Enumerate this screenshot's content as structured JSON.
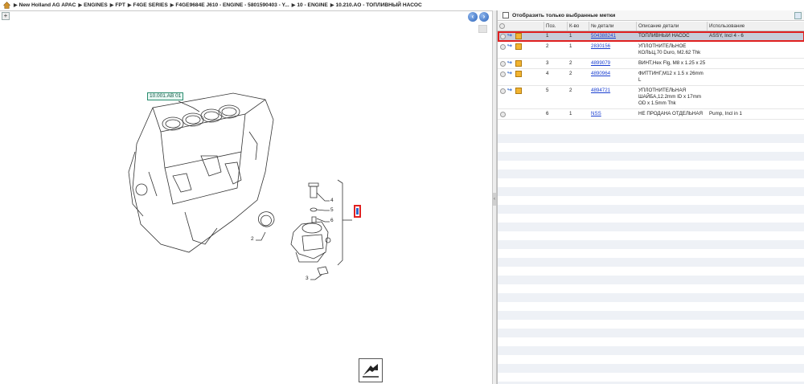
{
  "breadcrumb": {
    "items": [
      "New Holland AG APAC",
      "ENGINES",
      "FPT",
      "F4GE SERIES",
      "F4GE9684E J610 - ENGINE - 5801590403 - Y...",
      "10 - ENGINE",
      "10.210.AO - ТОПЛИВНЫЙ НАСОС"
    ]
  },
  "drawing": {
    "reference_label": "10.001.AB 01",
    "callouts": [
      "2",
      "3",
      "4",
      "5",
      "6"
    ]
  },
  "filter": {
    "label": "Отобразить только выбранные метки"
  },
  "grid": {
    "headers": {
      "pos": "Поз.",
      "qty": "К-во",
      "number": "№ детали",
      "description": "Описание детали",
      "usage": "Использование"
    },
    "rows": [
      {
        "pos": "1",
        "qty": "1",
        "number": "504388241",
        "description": "ТОПЛИВНЫЙ НАСОС",
        "usage": "ASSY, Incl 4 - 6",
        "selected": true,
        "icons": true
      },
      {
        "pos": "2",
        "qty": "1",
        "number": "2830156",
        "description": "УПЛОТНИТЕЛЬНОЕ КОЛЬЦ,70 Duro, M2.62 Thk",
        "usage": "",
        "selected": false,
        "icons": true
      },
      {
        "pos": "3",
        "qty": "2",
        "number": "4899079",
        "description": "ВИНТ,Hex Flg, M8 x 1.25 x 25",
        "usage": "",
        "selected": false,
        "icons": true
      },
      {
        "pos": "4",
        "qty": "2",
        "number": "4890964",
        "description": "ФИТТИНГ,M12 x 1.5 x 26mm L",
        "usage": "",
        "selected": false,
        "icons": true
      },
      {
        "pos": "5",
        "qty": "2",
        "number": "4894721",
        "description": "УПЛОТНИТЕЛЬНАЯ ШАЙБА,12.2mm ID x 17mm OD x 1.5mm Thk",
        "usage": "",
        "selected": false,
        "icons": true
      },
      {
        "pos": "6",
        "qty": "1",
        "number": "NSS",
        "description": "НЕ ПРОДАНА ОТДЕЛЬНАЯ",
        "usage": "Pump, Incl in 1",
        "selected": false,
        "icons": false
      }
    ]
  }
}
